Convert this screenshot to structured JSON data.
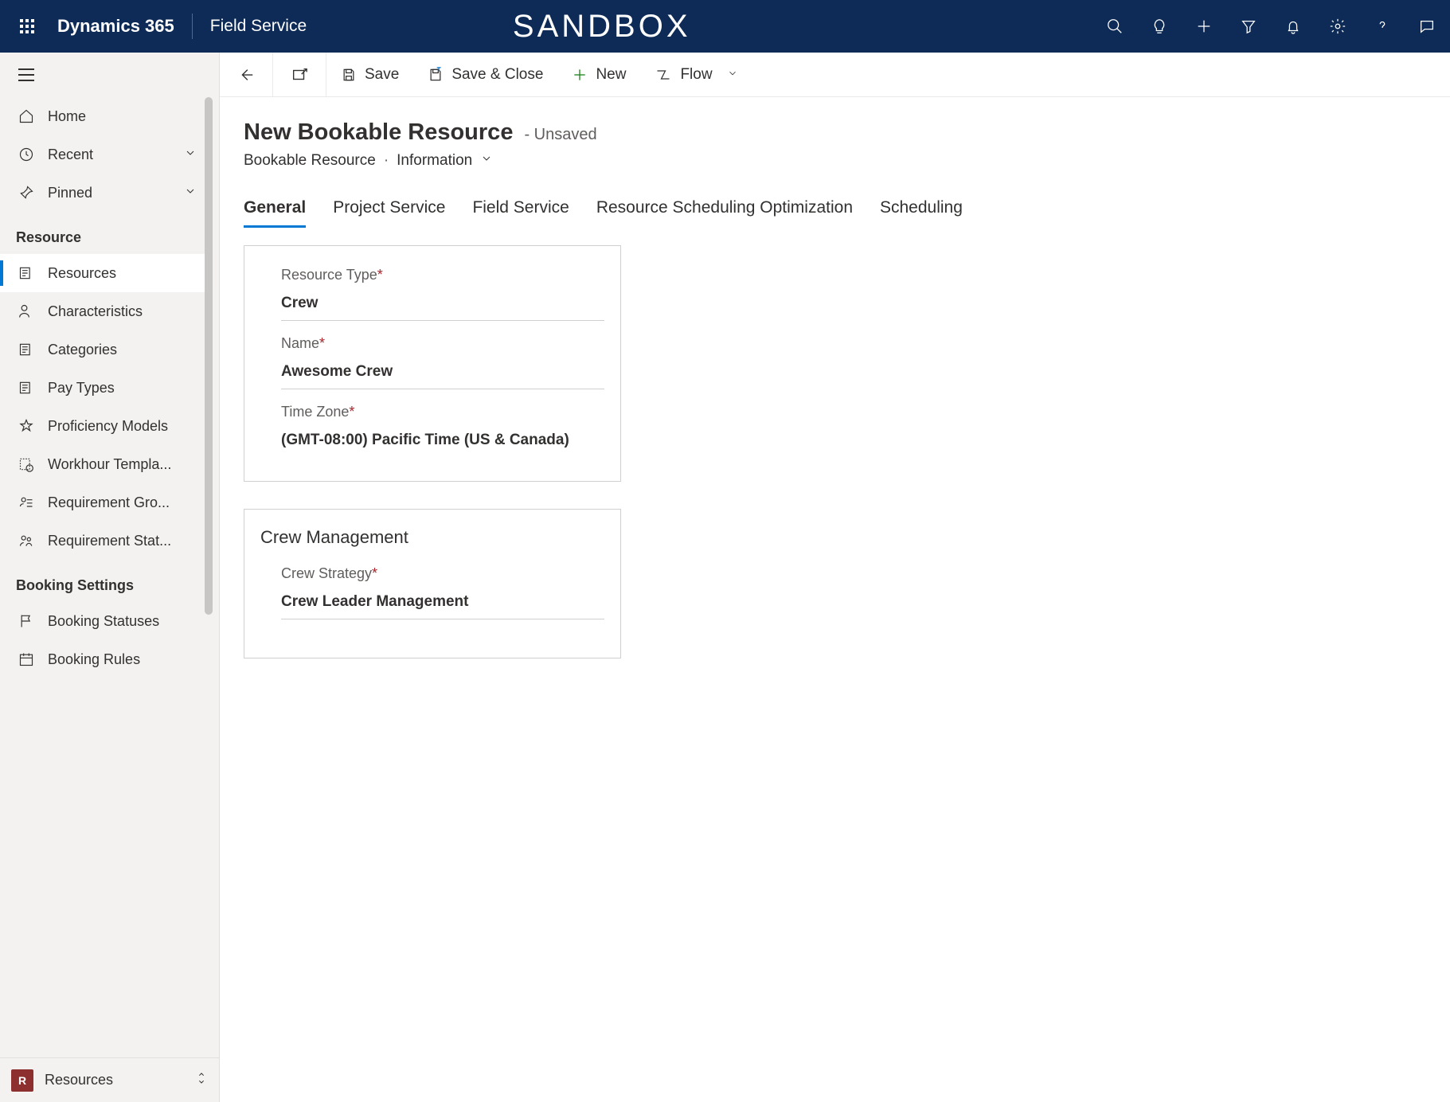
{
  "topbar": {
    "brand": "Dynamics 365",
    "app": "Field Service",
    "env": "SANDBOX"
  },
  "sidebar": {
    "home": "Home",
    "recent": "Recent",
    "pinned": "Pinned",
    "group_resource": "Resource",
    "items": [
      {
        "label": "Resources"
      },
      {
        "label": "Characteristics"
      },
      {
        "label": "Categories"
      },
      {
        "label": "Pay Types"
      },
      {
        "label": "Proficiency Models"
      },
      {
        "label": "Workhour Templa..."
      },
      {
        "label": "Requirement Gro..."
      },
      {
        "label": "Requirement Stat..."
      }
    ],
    "group_booking": "Booking Settings",
    "booking": [
      {
        "label": "Booking Statuses"
      },
      {
        "label": "Booking Rules"
      }
    ],
    "footer": {
      "letter": "R",
      "label": "Resources"
    }
  },
  "cmdbar": {
    "save": "Save",
    "save_close": "Save & Close",
    "new": "New",
    "flow": "Flow"
  },
  "page": {
    "title": "New Bookable Resource",
    "status": "- Unsaved",
    "bc1": "Bookable Resource",
    "bc2": "Information"
  },
  "tabs": [
    "General",
    "Project Service",
    "Field Service",
    "Resource Scheduling Optimization",
    "Scheduling"
  ],
  "form": {
    "resource_type": {
      "label": "Resource Type",
      "value": "Crew"
    },
    "name": {
      "label": "Name",
      "value": "Awesome Crew"
    },
    "timezone": {
      "label": "Time Zone",
      "value": "(GMT-08:00) Pacific Time (US & Canada)"
    },
    "section2": "Crew Management",
    "crew_strategy": {
      "label": "Crew Strategy",
      "value": "Crew Leader Management"
    }
  }
}
